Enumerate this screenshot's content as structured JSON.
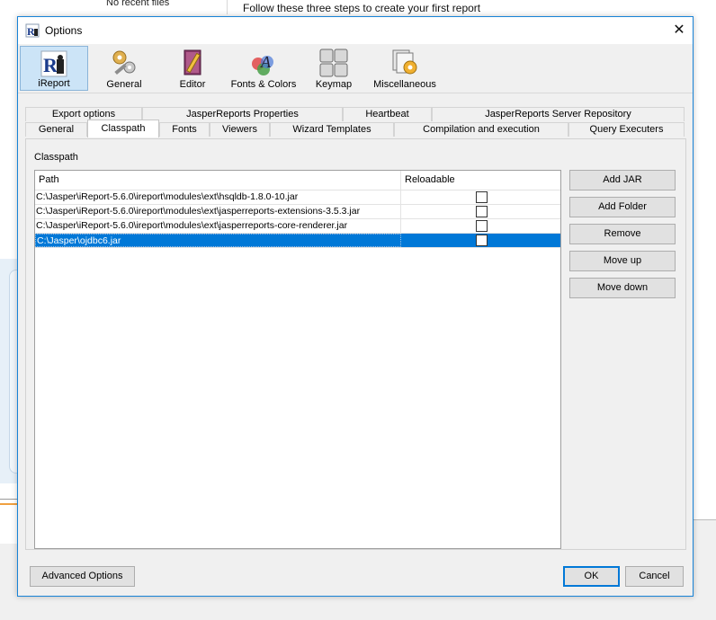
{
  "background": {
    "left_panel_text": "No recent files",
    "follow_steps_text": "Follow these three steps to create your first report"
  },
  "dialog": {
    "title": "Options",
    "close_glyph": "✕"
  },
  "toolbar": {
    "items": [
      {
        "label": "iReport",
        "icon": "ireport-icon",
        "selected": true
      },
      {
        "label": "General",
        "icon": "gears-wrench-icon"
      },
      {
        "label": "Editor",
        "icon": "book-pencil-icon"
      },
      {
        "label": "Fonts & Colors",
        "icon": "fonts-colors-icon"
      },
      {
        "label": "Keymap",
        "icon": "keyboard-keys-icon"
      },
      {
        "label": "Miscellaneous",
        "icon": "documents-gear-icon"
      }
    ]
  },
  "tabs": {
    "row1": [
      "Export options",
      "JasperReports Properties",
      "Heartbeat",
      "JasperReports Server Repository"
    ],
    "row2": [
      "General",
      "Classpath",
      "Fonts",
      "Viewers",
      "Wizard Templates",
      "Compilation and execution",
      "Query Executers"
    ],
    "active": "Classpath"
  },
  "classpath": {
    "section_label": "Classpath",
    "columns": [
      "Path",
      "Reloadable"
    ],
    "rows": [
      {
        "path": "C:\\Jasper\\iReport-5.6.0\\ireport\\modules\\ext\\hsqldb-1.8.0-10.jar",
        "reloadable": false
      },
      {
        "path": "C:\\Jasper\\iReport-5.6.0\\ireport\\modules\\ext\\jasperreports-extensions-3.5.3.jar",
        "reloadable": false
      },
      {
        "path": "C:\\Jasper\\iReport-5.6.0\\ireport\\modules\\ext\\jasperreports-core-renderer.jar",
        "reloadable": false
      },
      {
        "path": "C:\\Jasper\\ojdbc6.jar",
        "reloadable": false,
        "selected": true
      }
    ],
    "buttons": [
      "Add JAR",
      "Add Folder",
      "Remove",
      "Move up",
      "Move down"
    ]
  },
  "footer": {
    "advanced_label": "Advanced Options",
    "ok_label": "OK",
    "cancel_label": "Cancel"
  },
  "colors": {
    "selection": "#0078d7",
    "dialog_border": "#1883d7",
    "selected_toolbar_bg": "#cce4f7"
  }
}
